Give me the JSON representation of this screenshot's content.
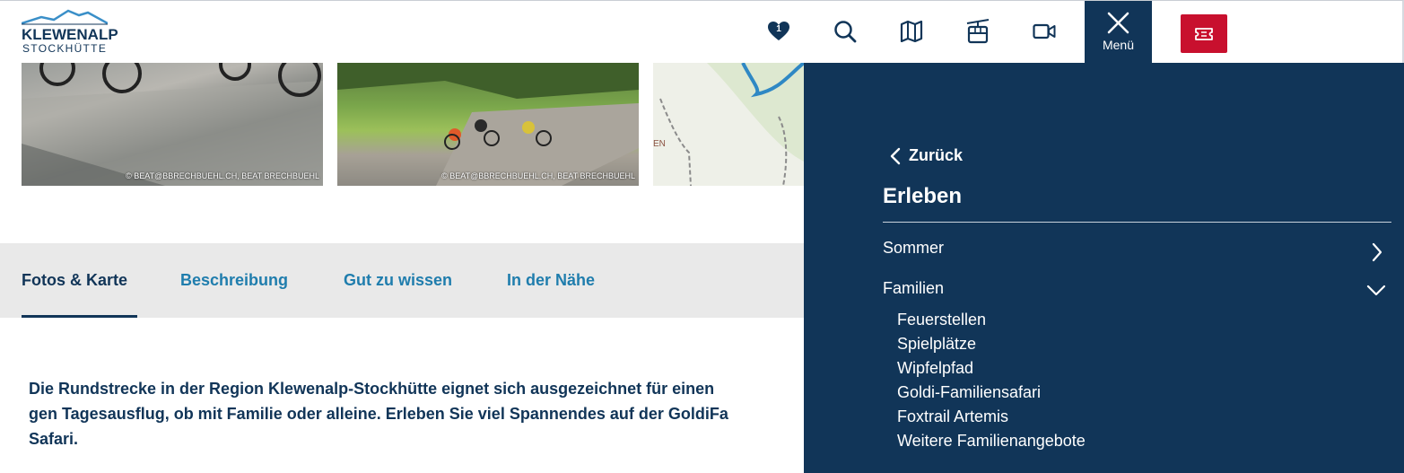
{
  "brand": {
    "name": "KLEWENALP",
    "sub": "STOCKHÜTTE"
  },
  "header": {
    "favorites_count": "1",
    "menu_label": "Menü",
    "accent_color": "#113558",
    "ticket_color": "#c8102e"
  },
  "icons": [
    "heart-icon",
    "search-icon",
    "map-icon",
    "cable-car-icon",
    "video-icon",
    "close-icon",
    "ticket-icon"
  ],
  "gallery": {
    "credit1": "© BEAT@BBRECHBUEHL.CH, BEAT BRECHBUEHL",
    "credit2": "© BEAT@BBRECHBUEHL.CH, BEAT BRECHBUEHL",
    "map_fragment": "EN"
  },
  "tabs": [
    "Fotos & Karte",
    "Beschreibung",
    "Gut zu wissen",
    "In der Nähe"
  ],
  "intro": [
    "Die Rundstrecke in der Region Klewenalp-Stockhütte eignet sich ausgezeichnet für einen",
    "gen Tagesausflug, ob mit Familie oder alleine. Erleben Sie viel Spannendes auf der GoldiFa",
    "Safari."
  ],
  "menu_panel": {
    "back_label": "Zurück",
    "title": "Erleben",
    "sections": [
      "Sommer",
      "Familien"
    ],
    "familien_items": [
      "Feuerstellen",
      "Spielplätze",
      "Wipfelpfad",
      "Goldi-Familiensafari",
      "Foxtrail Artemis",
      "Weitere Familienangebote"
    ]
  }
}
